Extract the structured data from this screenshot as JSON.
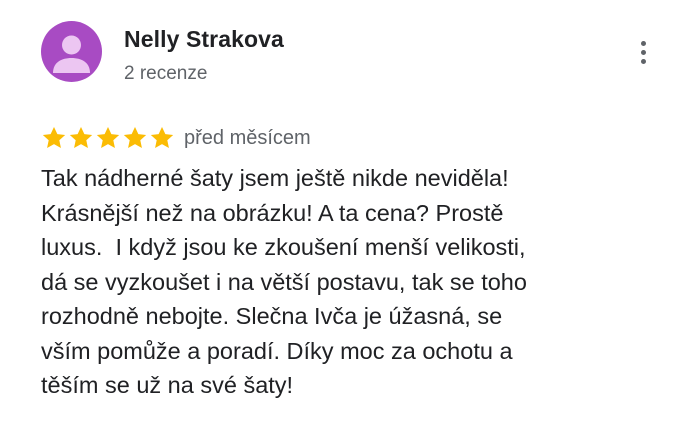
{
  "review": {
    "author": "Nelly Strakova",
    "review_count": "2 recenze",
    "avatar_color": "#a84bc3",
    "rating": 5,
    "star_color": "#fbbc04",
    "date": "před měsícem",
    "text_lines": [
      "Tak nádherné šaty jsem ještě nikde neviděla!",
      "Krásnější než na obrázku! A ta cena? Prostě",
      "luxus.  I když jsou ke zkoušení menší velikosti,",
      "dá se vyzkoušet i na větší postavu, tak se toho",
      "rozhodně nebojte. Slečna Ivča je úžasná, se",
      "vším pomůže a poradí. Díky moc za ochotu a",
      "těším se už na své šaty!"
    ]
  },
  "icons": {
    "avatar": "person-icon",
    "menu": "more-vertical-icon",
    "star": "star-icon"
  }
}
